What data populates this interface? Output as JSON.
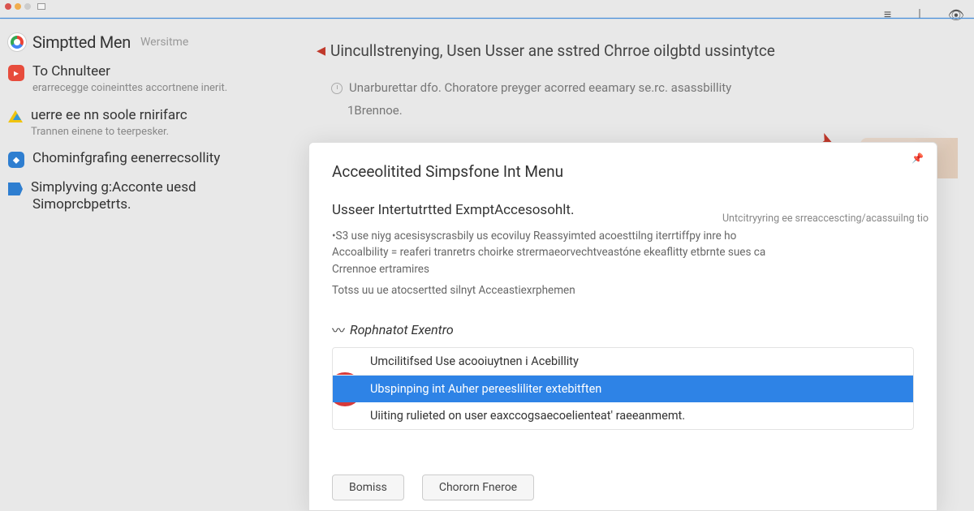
{
  "titlebar": {
    "icons": [
      "≡",
      "⟘",
      "👁"
    ]
  },
  "sidebar": {
    "title": "Simptted Men",
    "subtitle": "Wersitme",
    "items": [
      {
        "title": "To Chnulteer",
        "desc": "erarrecegge coineinttes accortnene inerit."
      },
      {
        "title": "uerre ee nn soole rnirifarc",
        "desc": "Trannen einene to teerpesker."
      },
      {
        "title": "Chominfgrafing eenerrecsollity",
        "desc": ""
      },
      {
        "title": "Simplyving g:Acconte uesd",
        "desc": ""
      }
    ],
    "extra_line": "Simoprcbpetrts."
  },
  "main": {
    "title": "Uincullstrenying, Usen Usser ane sstred Chrroe oilgbtd ussintytce",
    "subtitle": "Unarburettar dfo. Choratore preyger acorred eeamary se.rc. asassbillity",
    "subtitle2": "1Brennoe."
  },
  "dialog": {
    "title": "Acceeolitited Simpsfone Int Menu",
    "subtitle": "Usseer Intertutrtted ExmptAccesosohlt.",
    "right_note": "Untcitryyring ee srreaccescting/acassuilng tio",
    "body": [
      "•S3 use niyg acesisyscrasbily us ecoviluy Reassyimted acoesttilng iterrtiffpy inre ho Accoalbility = reaferi tranretrs choirke strermaeorvechtveastóne ekeaflitty etbrnte sues ca Crrennoe ertramires",
      "Totss uu ue atocsertted silnyt Acceastiexrphemen"
    ],
    "section_title": "Rophnatot Exentro",
    "options": [
      "Umcilitifsed Use acooiuytnen i Acebillity",
      "Ubspinping int Auher pereesliliter extebitften",
      "Uiiting rulieted on user eaxccogsaecoelienteat' raeeanmemt."
    ],
    "buttons": {
      "primary": "Bomiss",
      "secondary": "Chororn Fneroe"
    }
  }
}
